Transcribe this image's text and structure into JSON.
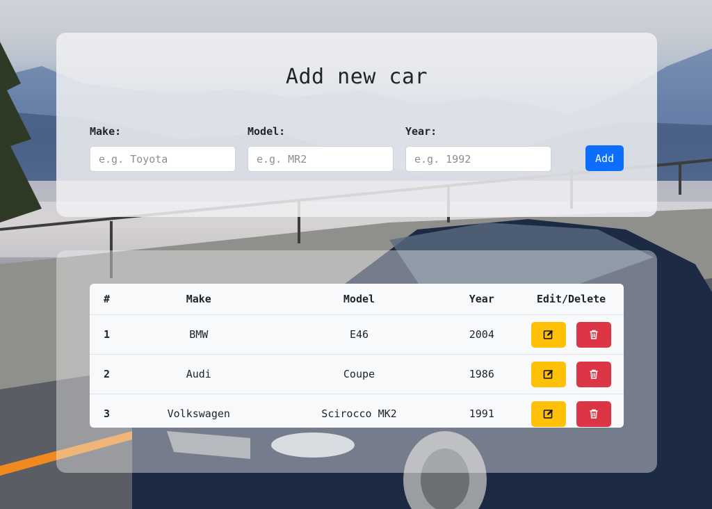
{
  "form": {
    "title": "Add new car",
    "make_label": "Make:",
    "make_placeholder": "e.g. Toyota",
    "model_label": "Model:",
    "model_placeholder": "e.g. MR2",
    "year_label": "Year:",
    "year_placeholder": "e.g. 1992",
    "add_label": "Add"
  },
  "table": {
    "headers": {
      "num": "#",
      "make": "Make",
      "model": "Model",
      "year": "Year",
      "actions": "Edit/Delete"
    },
    "rows": [
      {
        "num": "1",
        "make": "BMW",
        "model": "E46",
        "year": "2004"
      },
      {
        "num": "2",
        "make": "Audi",
        "model": "Coupe",
        "year": "1986"
      },
      {
        "num": "3",
        "make": "Volkswagen",
        "model": "Scirocco MK2",
        "year": "1991"
      }
    ]
  },
  "icons": {
    "edit": "edit-icon",
    "delete": "trash-icon"
  },
  "colors": {
    "primary": "#0d6efd",
    "edit": "#ffc107",
    "delete": "#dc3545"
  }
}
